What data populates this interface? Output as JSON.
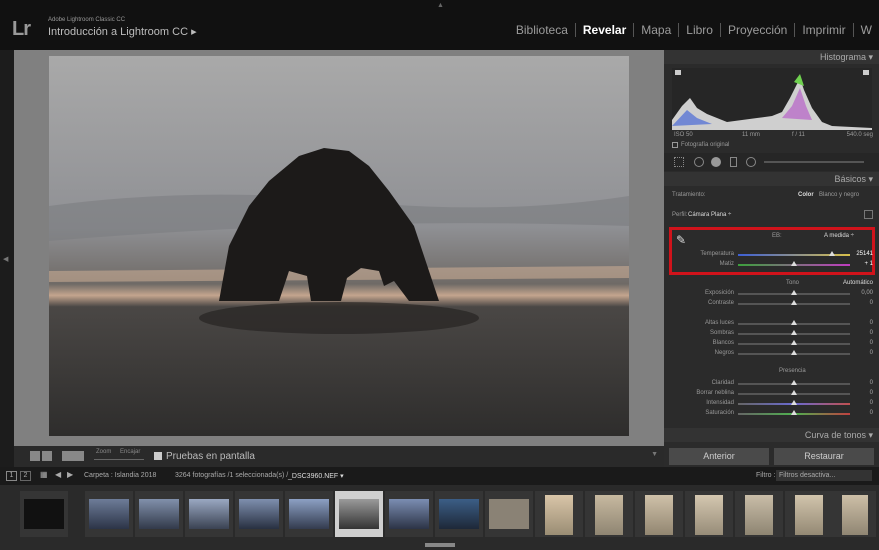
{
  "app": {
    "logo": "Lr",
    "version": "Adobe Lightroom Classic CC",
    "catalog": "Introducción a Lightroom CC ▸"
  },
  "modules": [
    "Biblioteca",
    "Revelar",
    "Mapa",
    "Libro",
    "Proyección",
    "Imprimir",
    "W"
  ],
  "active_module": "Revelar",
  "toolbar": {
    "zoom": "Zoom",
    "fit": "Encajar",
    "softproof": "Pruebas en pantalla"
  },
  "histogram": {
    "title": "Histograma",
    "iso": "ISO 50",
    "focal": "11 mm",
    "aperture": "f / 11",
    "shutter": "540.0 seg",
    "original": "Fotografía original"
  },
  "basics": {
    "title": "Básicos",
    "treatment_label": "Tratamiento:",
    "color": "Color",
    "bw": "Blanco y negro",
    "profile_label": "Perfil:",
    "profile": "Cámara Plana ÷",
    "wb_label": "EB:",
    "wb_value": "A medida ÷",
    "temp_label": "Temperatura",
    "temp_value": "25141",
    "tint_label": "Matiz",
    "tint_value": "+ 1",
    "tone": "Tono",
    "auto": "Automático",
    "exposure_label": "Exposición",
    "exposure_value": "0,00",
    "contrast_label": "Contraste",
    "contrast_value": "0",
    "highlights_label": "Altas luces",
    "highlights_value": "0",
    "shadows_label": "Sombras",
    "shadows_value": "0",
    "whites_label": "Blancos",
    "whites_value": "0",
    "blacks_label": "Negros",
    "blacks_value": "0",
    "presence": "Presencia",
    "clarity_label": "Claridad",
    "clarity_value": "0",
    "dehaze_label": "Borrar neblina",
    "dehaze_value": "0",
    "vibrance_label": "Intensidad",
    "vibrance_value": "0",
    "saturation_label": "Saturación",
    "saturation_value": "0"
  },
  "tone_curve": "Curva de tonos",
  "buttons": {
    "previous": "Anterior",
    "reset": "Restaurar"
  },
  "filmbar": {
    "pages": [
      "1",
      "2"
    ],
    "path": "Carpeta : Islandia 2018",
    "count": "3264 fotografías /1 seleccionada(s) /",
    "file": "_DSC3960.NEF ▾",
    "filter_label": "Filtro :",
    "filter_value": "Filtros desactiva..."
  },
  "colors": {
    "accent_red": "#d0131b",
    "panel": "#2b2b2b"
  }
}
